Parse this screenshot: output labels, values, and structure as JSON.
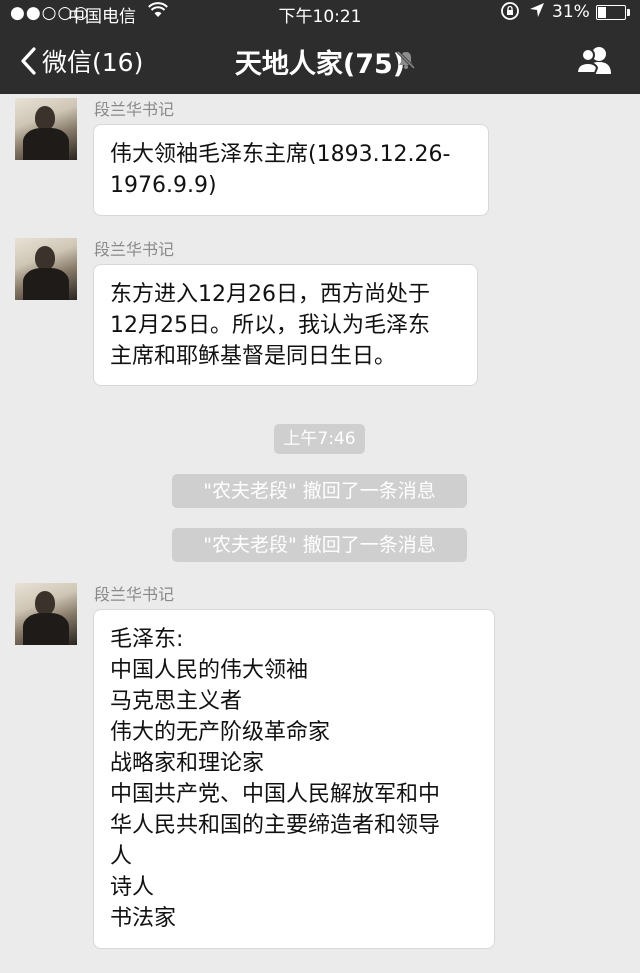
{
  "status_bar": {
    "signal": "●●○○○",
    "carrier": "中国电信",
    "time": "下午10:21",
    "battery_text": "31%",
    "battery_level": 0.31
  },
  "nav": {
    "back_label": "微信(16)",
    "title": "天地人家(75)"
  },
  "messages": [
    {
      "sender": "段兰华书记",
      "lines": [
        "伟大领袖毛泽东主席(1893.12.26-",
        "1976.9.9)"
      ]
    },
    {
      "sender": "段兰华书记",
      "lines": [
        "东方进入12月26日，西方尚处于",
        "12月25日。所以，我认为毛泽东",
        "主席和耶稣基督是同日生日。"
      ]
    },
    {
      "sender": "段兰华书记",
      "lines": [
        "毛泽东:",
        "中国人民的伟大领袖",
        "马克思主义者",
        "伟大的无产阶级革命家",
        "战略家和理论家",
        "中国共产党、中国人民解放军和中",
        "华人民共和国的主要缔造者和领导",
        "人",
        "诗人",
        "书法家"
      ]
    }
  ],
  "timestamp": "上午7:46",
  "system_notices": [
    "\"农夫老段\" 撤回了一条消息",
    "\"农夫老段\" 撤回了一条消息"
  ]
}
